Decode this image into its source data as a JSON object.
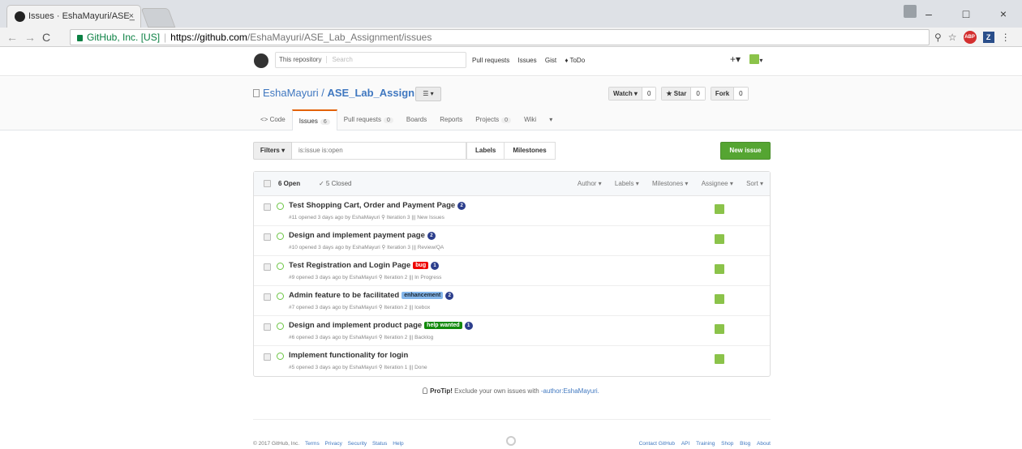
{
  "browser": {
    "tab_title": "Issues · EshaMayuri/ASE_",
    "close_glyph": "×",
    "window": {
      "minimize": "–",
      "maximize": "□",
      "close": "×"
    },
    "nav": {
      "back": "←",
      "forward": "→",
      "reload": "C"
    },
    "security_label": "GitHub, Inc. [US]",
    "url_host": "https://github.com",
    "url_path": "/EshaMayuri/ASE_Lab_Assignment/issues",
    "ext": {
      "zoom": "⚲",
      "star": "☆",
      "abp": "ABP",
      "zotero": "Z",
      "menu": "⋮"
    }
  },
  "header": {
    "scope": "This repository",
    "search_placeholder": "Search",
    "nav": [
      "Pull requests",
      "Issues",
      "Gist",
      "♦ ToDo"
    ],
    "plus": "+▾",
    "avatar_caret": "▾"
  },
  "repo": {
    "owner": "EshaMayuri",
    "slash": " / ",
    "name": "ASE_Lab_Assignment",
    "list_btn": "☰ ▾",
    "watch": {
      "label": "Watch ▾",
      "count": "0"
    },
    "star": {
      "label": "★ Star",
      "count": "0"
    },
    "fork": {
      "label": "Fork",
      "count": "0"
    }
  },
  "tabs": [
    {
      "label": "<> Code",
      "count": ""
    },
    {
      "label": "Issues",
      "count": "6"
    },
    {
      "label": "Pull requests",
      "count": "0"
    },
    {
      "label": "Boards",
      "count": ""
    },
    {
      "label": "Reports",
      "count": ""
    },
    {
      "label": "Projects",
      "count": "0"
    },
    {
      "label": "Wiki",
      "count": ""
    }
  ],
  "filters": {
    "filter_btn": "Filters ▾",
    "search_value": "is:issue is:open",
    "labels": "Labels",
    "milestones": "Milestones",
    "new_issue": "New issue"
  },
  "issues_header": {
    "open": "6 Open",
    "closed": "✓ 5 Closed",
    "author": "Author ▾",
    "labels": "Labels ▾",
    "milestones": "Milestones ▾",
    "assignee": "Assignee ▾",
    "sort": "Sort ▾"
  },
  "issues": [
    {
      "title": "Test Shopping Cart, Order and Payment Page",
      "label": "",
      "comments": "2",
      "meta": "#11 opened 3 days ago by EshaMayuri   ⚲ Iteration 3   ||| New Issues"
    },
    {
      "title": "Design and implement payment page",
      "label": "",
      "comments": "2",
      "meta": "#10 opened 3 days ago by EshaMayuri   ⚲ Iteration 3   ||| Review/QA"
    },
    {
      "title": "Test Registration and Login Page",
      "label": "bug",
      "comments": "1",
      "meta": "#9 opened 3 days ago by EshaMayuri   ⚲ Iteration 2   ||| In Progress"
    },
    {
      "title": "Admin feature to be facilitated",
      "label": "enhancement",
      "comments": "2",
      "meta": "#7 opened 3 days ago by EshaMayuri   ⚲ Iteration 2   ||| Icebox"
    },
    {
      "title": "Design and implement product page",
      "label": "help wanted",
      "comments": "1",
      "meta": "#6 opened 3 days ago by EshaMayuri   ⚲ Iteration 2   ||| Backlog"
    },
    {
      "title": "Implement functionality for login",
      "label": "",
      "comments": "",
      "meta": "#5 opened 3 days ago by EshaMayuri   ⚲ Iteration 1   ||| Done"
    }
  ],
  "protip": {
    "bold": "ProTip!",
    "text": " Exclude your own issues with ",
    "query": "-author:EshaMayuri."
  },
  "footer": {
    "copyright": "© 2017 GitHub, Inc.",
    "left_links": [
      "Terms",
      "Privacy",
      "Security",
      "Status",
      "Help"
    ],
    "right_links": [
      "Contact GitHub",
      "API",
      "Training",
      "Shop",
      "Blog",
      "About"
    ]
  },
  "colors": {
    "accent": "#4078c0",
    "new_issue": "#55a532",
    "open_icon": "#6cc644",
    "bug": "#ee0701",
    "enhancement": "#84b6eb",
    "help_wanted": "#128a0c"
  }
}
